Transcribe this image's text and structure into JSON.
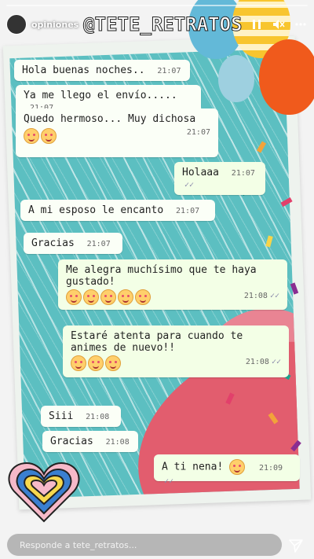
{
  "header": {
    "username": "opiniones",
    "title": "@TETE_RETRATOS",
    "icons": [
      "pause-icon",
      "mute-icon",
      "more-icon"
    ]
  },
  "messages": [
    {
      "text": "Hola buenas noches..",
      "time": "21:07",
      "direction": "in"
    },
    {
      "text": "Ya me llego el envío.....",
      "time": "21:07",
      "direction": "in"
    },
    {
      "text": "Quedo hermoso... Muy dichosa",
      "time": "21:07",
      "direction": "in",
      "emojis": 2
    },
    {
      "text": "Holaaa",
      "time": "21:07",
      "direction": "out"
    },
    {
      "text": "A mi esposo le encanto",
      "time": "21:07",
      "direction": "in"
    },
    {
      "text": "Gracias",
      "time": "21:07",
      "direction": "in"
    },
    {
      "text": "Me alegra muchísimo que te haya gustado!",
      "time": "21:08",
      "direction": "out",
      "emojis": 5
    },
    {
      "text": "Estaré atenta para cuando te animes de nuevo!!",
      "time": "21:08",
      "direction": "out",
      "emojis": 3
    },
    {
      "text": "Siii",
      "time": "21:08",
      "direction": "in"
    },
    {
      "text": "Gracias",
      "time": "21:08",
      "direction": "in"
    },
    {
      "text": "A ti nena!",
      "time": "21:09",
      "direction": "out",
      "emojis": 1
    }
  ],
  "reply": {
    "placeholder": "Responde a tete_retratos..."
  },
  "colors": {
    "chat_bg": "#5cbfc1",
    "bubble": "#fbfff7",
    "umbrella": "#e25d6e"
  }
}
